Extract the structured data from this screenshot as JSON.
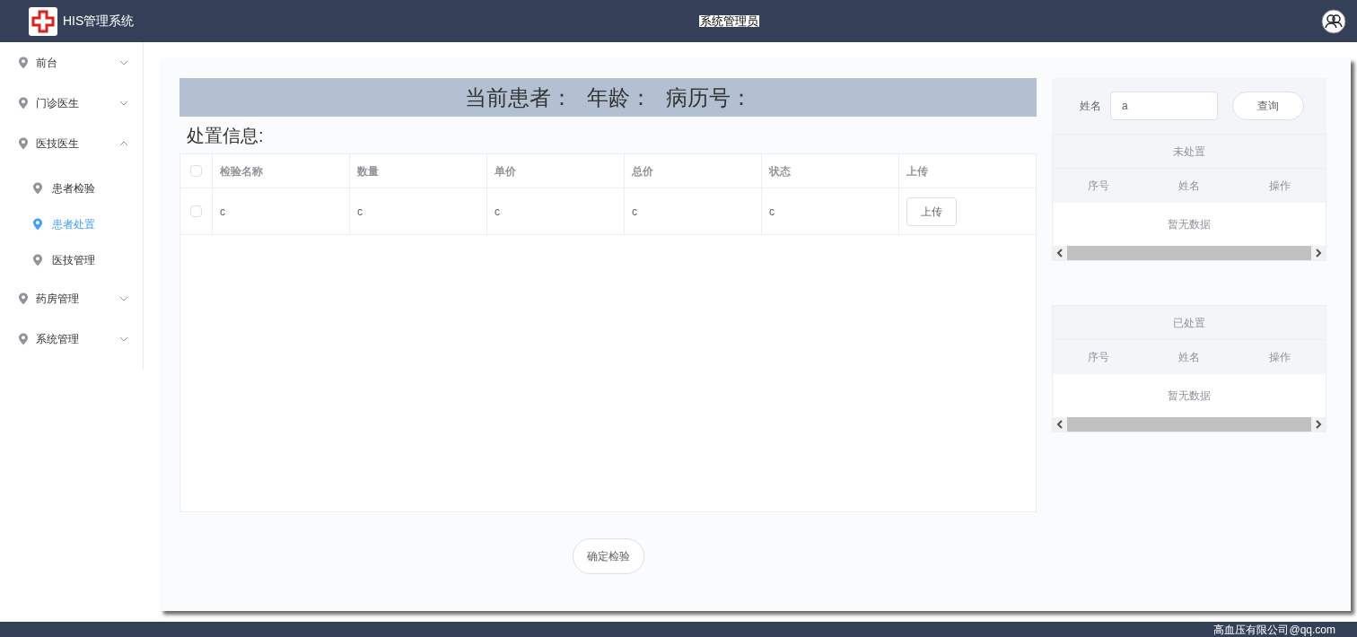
{
  "header": {
    "app_title": "HIS管理系统",
    "user_role": "系统管理员"
  },
  "sidebar": {
    "items": [
      {
        "label": "前台",
        "expanded": false
      },
      {
        "label": "门诊医生",
        "expanded": false
      },
      {
        "label": "医技医生",
        "expanded": true,
        "children": [
          {
            "label": "患者检验",
            "selected": false
          },
          {
            "label": "患者处置",
            "selected": true
          },
          {
            "label": "医技管理",
            "selected": false
          }
        ]
      },
      {
        "label": "药房管理",
        "expanded": false
      },
      {
        "label": "系统管理",
        "expanded": false
      }
    ]
  },
  "patient_banner": [
    "当前患者：",
    "年龄：",
    "病历号："
  ],
  "section_title": "处置信息:",
  "table": {
    "select_all_checked": false,
    "columns": [
      "检验名称",
      "数量",
      "单价",
      "总价",
      "状态",
      "上传"
    ],
    "rows": [
      {
        "checked": false,
        "cells": [
          "c",
          "c",
          "c",
          "c",
          "c"
        ],
        "action": "上传"
      }
    ]
  },
  "confirm_button": "确定检验",
  "search": {
    "label": "姓名",
    "value": "a",
    "button": "查询"
  },
  "lists": [
    {
      "title": "未处置",
      "columns": [
        "序号",
        "姓名",
        "操作"
      ],
      "empty_text": "暂无数据"
    },
    {
      "title": "已处置",
      "columns": [
        "序号",
        "姓名",
        "操作"
      ],
      "empty_text": "暂无数据"
    }
  ],
  "footer": "高血压有限公司@qq.com"
}
